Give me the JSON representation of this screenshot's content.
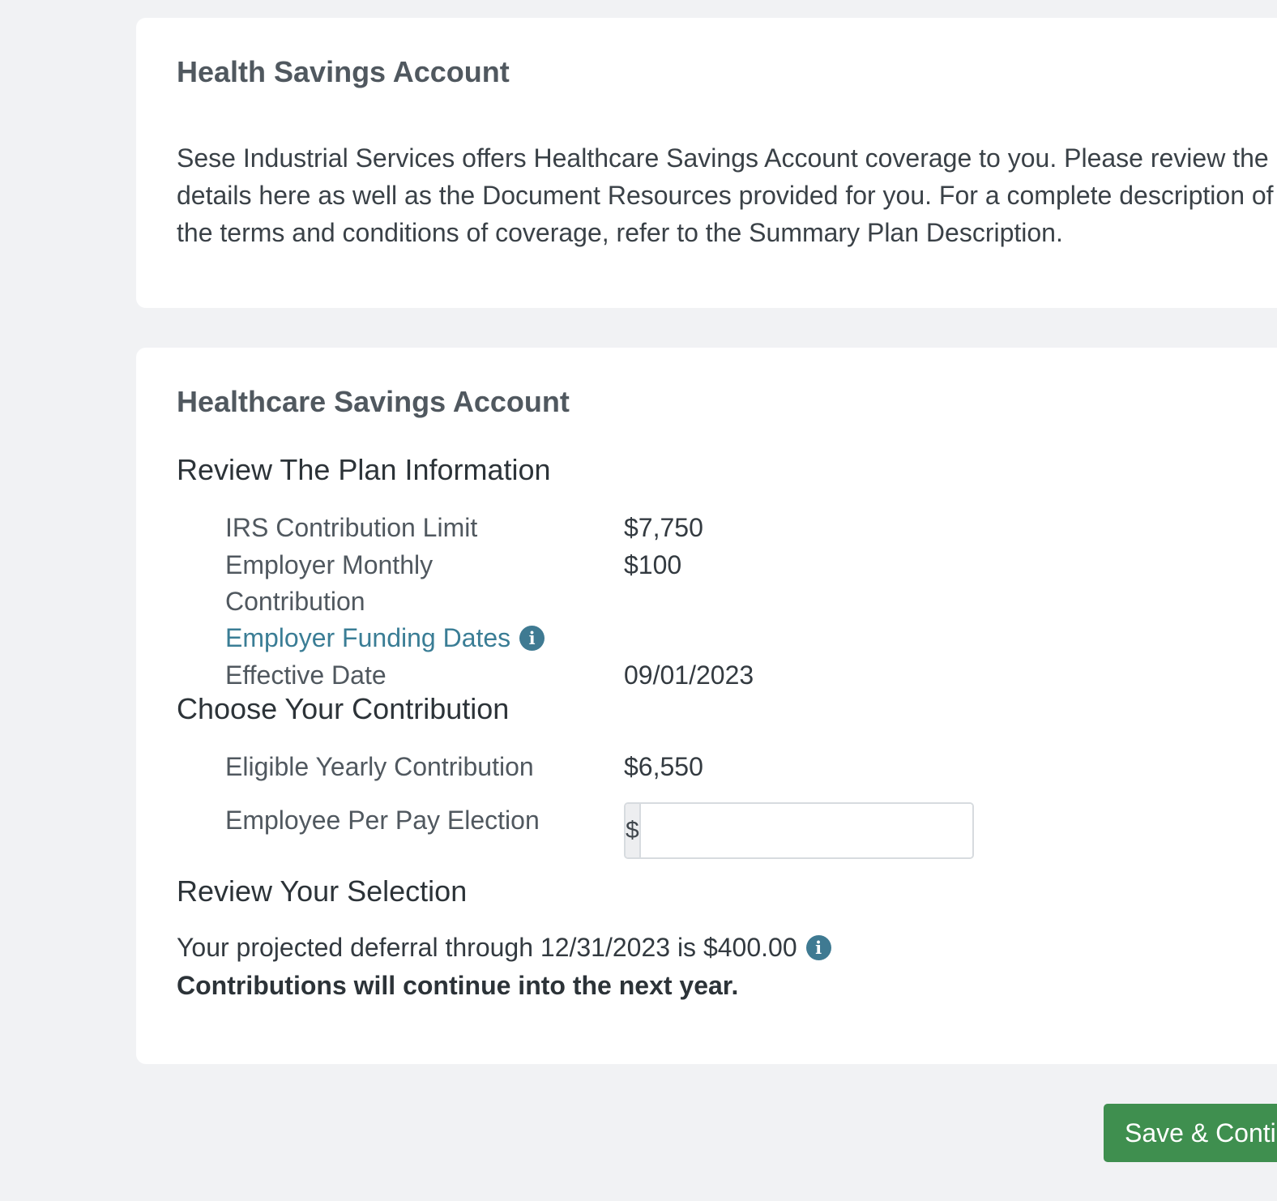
{
  "hsa_card": {
    "title": "Health Savings Account",
    "intro": "Sese Industrial Services offers Healthcare Savings Account coverage to you.  Please review the details here as well as the Document Resources provided for you.  For a complete description of the terms and conditions of coverage, refer to the Summary Plan Description."
  },
  "plan_card": {
    "title": "Healthcare Savings Account",
    "review_plan": {
      "heading": "Review The Plan Information",
      "irs_limit_label": "IRS Contribution Limit",
      "irs_limit_value": "$7,750",
      "employer_monthly_label": "Employer Monthly Contribution",
      "employer_monthly_value": "$100",
      "funding_dates_label": "Employer Funding Dates",
      "funding_dates_icon": "info-circle-icon",
      "effective_date_label": "Effective Date",
      "effective_date_value": "09/01/2023"
    },
    "choose": {
      "heading": "Choose Your Contribution",
      "eligible_label": "Eligible Yearly Contribution",
      "eligible_value": "$6,550",
      "election_label": "Employee Per Pay Election",
      "currency_symbol": "$",
      "election_value": ""
    },
    "review_selection": {
      "heading": "Review Your Selection",
      "projection": "Your projected deferral through 12/31/2023 is $400.00",
      "projection_icon": "info-circle-icon",
      "continue_note": "Contributions will continue into the next year."
    }
  },
  "footer": {
    "save_label": "Save & Continue"
  },
  "colors": {
    "page_bg": "#f1f2f4",
    "link": "#3a7d95",
    "info_icon": "#3f7a92",
    "save_button": "#3f8f4f"
  }
}
